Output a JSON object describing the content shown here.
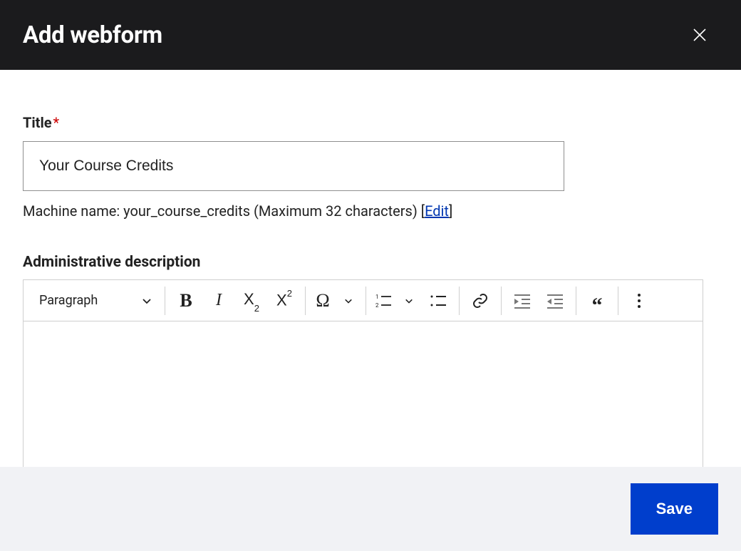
{
  "header": {
    "title": "Add webform"
  },
  "title_field": {
    "label": "Title",
    "required_mark": "*",
    "value": "Your Course Credits"
  },
  "machine_name": {
    "prefix": "Machine name: ",
    "value": "your_course_credits",
    "suffix": " (Maximum 32 characters) ",
    "edit_label": "Edit"
  },
  "admin_desc": {
    "label": "Administrative description"
  },
  "toolbar": {
    "paragraph_label": "Paragraph"
  },
  "footer": {
    "save_label": "Save"
  }
}
